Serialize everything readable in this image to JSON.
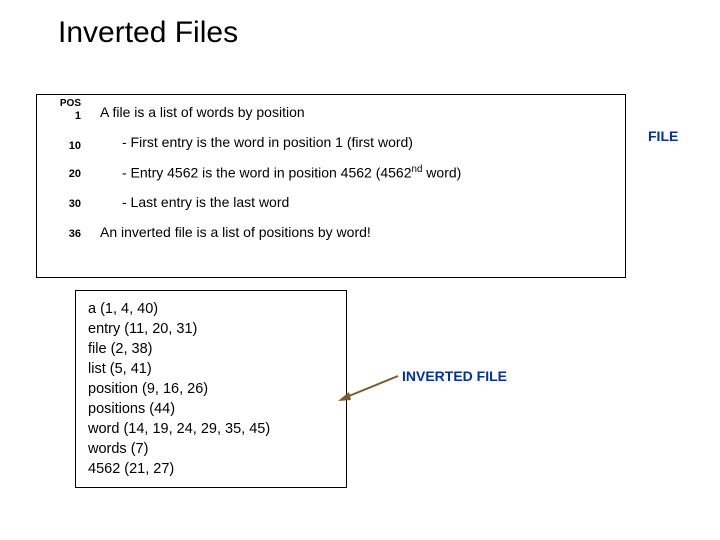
{
  "title": "Inverted Files",
  "pos_header": "POS",
  "positions": {
    "p1": "1",
    "p10": "10",
    "p20": "20",
    "p30": "30",
    "p36": "36"
  },
  "lines": {
    "l1": "A file is a list of words by position",
    "l2": "- First entry is the word in position 1 (first word)",
    "l3a": "- Entry 4562 is the word in position 4562 (4562",
    "l3b": "nd",
    "l3c": " word)",
    "l4": "- Last entry is the last word",
    "l5": "An inverted file is a list of positions by word!"
  },
  "file_label": "FILE",
  "inverted": {
    "r1": "a (1, 4, 40)",
    "r2": "entry (11, 20, 31)",
    "r3": "file (2, 38)",
    "r4": "list (5, 41)",
    "r5": "position (9, 16, 26)",
    "r6": "positions (44)",
    "r7": "word (14, 19, 24, 29, 35, 45)",
    "r8": "words (7)",
    "r9": "4562 (21, 27)"
  },
  "inverted_label": "INVERTED FILE"
}
